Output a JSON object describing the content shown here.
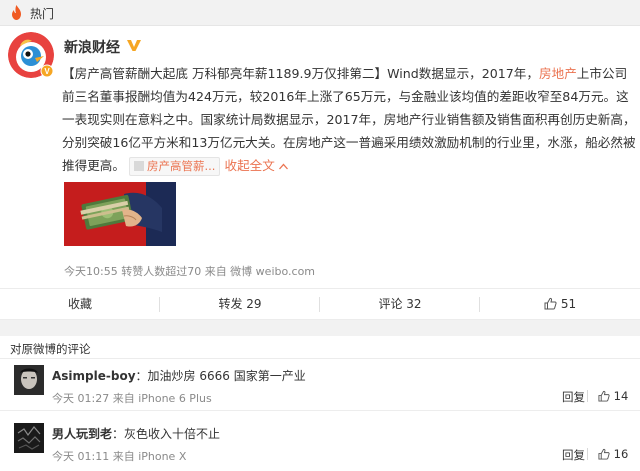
{
  "topbar": {
    "label": "热门",
    "icon": "flame-icon",
    "icon_color": "#f05a22"
  },
  "post": {
    "username": "新浪财经",
    "verified": true,
    "verified_color": "#f6a623",
    "text_before": "【房产高管薪酬大起底 万科郁亮年薪1189.9万仅排第二】Wind数据显示，2017年，",
    "highlight_word": "房地产",
    "text_after": "上市公司前三名董事报酬均值为424万元，较2016年上涨了65万元，与金融业该均值的差距收窄至84万元。这一表现实则在意料之中。国家统计局数据显示，2017年，房地产行业销售额及销售面积再创历史新高，分别突破16亿平方米和13万亿元大关。在房地产这一普遍采用绩效激励机制的行业里，水涨，船必然被推得更高。",
    "topic_link": "房产高管薪...",
    "expand_label": "收起全文",
    "expand_icon": "chevron-up-icon",
    "accent_color": "#eb7350",
    "meta": "今天10:55 转赞人数超过70 来自 微博 weibo.com"
  },
  "actions": {
    "collect": "收藏",
    "repost": "转发 29",
    "comment": "评论 32",
    "like_count": "51"
  },
  "comments_section": {
    "title": "对原微博的评论",
    "items": [
      {
        "user": "Asimple-boy",
        "text": "加油炒房 6666 国家第一产业",
        "meta": "今天 01:27 来自 iPhone 6 Plus",
        "reply": "回复",
        "likes": "14"
      },
      {
        "user": "男人玩到老",
        "text": "灰色收入十倍不止",
        "meta": "今天 01:11 来自 iPhone X",
        "reply": "回复",
        "likes": "16"
      }
    ]
  }
}
